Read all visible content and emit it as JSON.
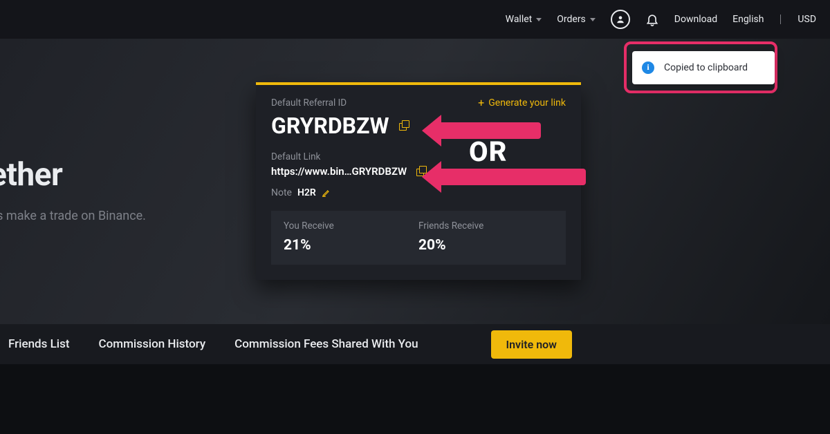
{
  "nav": {
    "wallet": "Wallet",
    "orders": "Orders",
    "download": "Download",
    "language": "English",
    "currency": "USD"
  },
  "hero": {
    "title_fragment": "ether",
    "subtitle_fragment": "ds make a trade on Binance."
  },
  "card": {
    "referral_id_label": "Default Referral ID",
    "generate_link": "Generate your link",
    "referral_id": "GRYRDBZW",
    "link_label": "Default Link",
    "link_value": "https://www.bin…GRYRDBZW",
    "note_label": "Note",
    "note_value": "H2R",
    "you_receive_label": "You Receive",
    "you_receive_value": "21%",
    "friends_receive_label": "Friends Receive",
    "friends_receive_value": "20%"
  },
  "tabs": {
    "friends_list": "Friends List",
    "commission_history": "Commission History",
    "commission_shared": "Commission Fees Shared With You",
    "invite": "Invite now"
  },
  "toast": {
    "message": "Copied to clipboard"
  },
  "annotation": {
    "or": "OR"
  }
}
